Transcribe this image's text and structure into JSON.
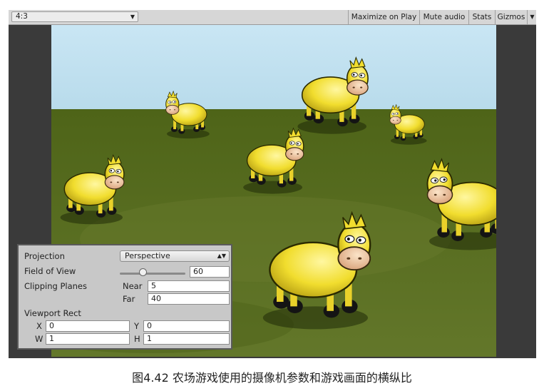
{
  "toolbar": {
    "aspect_label": "4:3",
    "maximize_label": "Maximize on Play",
    "mute_label": "Mute audio",
    "stats_label": "Stats",
    "gizmos_label": "Gizmos"
  },
  "camera_panel": {
    "projection_label": "Projection",
    "projection_value": "Perspective",
    "fov_label": "Field of View",
    "fov_value": "60",
    "fov_fraction": 0.35,
    "clipping_label": "Clipping Planes",
    "near_label": "Near",
    "near_value": "5",
    "far_label": "Far",
    "far_value": "40",
    "viewport_label": "Viewport Rect",
    "x_label": "X",
    "x_value": "0",
    "y_label": "Y",
    "y_value": "0",
    "w_label": "W",
    "w_value": "1",
    "h_label": "H",
    "h_value": "1"
  },
  "caption": "图4.42 农场游戏使用的摄像机参数和游戏画面的横纵比",
  "colors": {
    "sky": "#c6e4f2",
    "grass": "#586d22",
    "cow": "#f3e23a",
    "muzzle": "#f2c9a6"
  }
}
